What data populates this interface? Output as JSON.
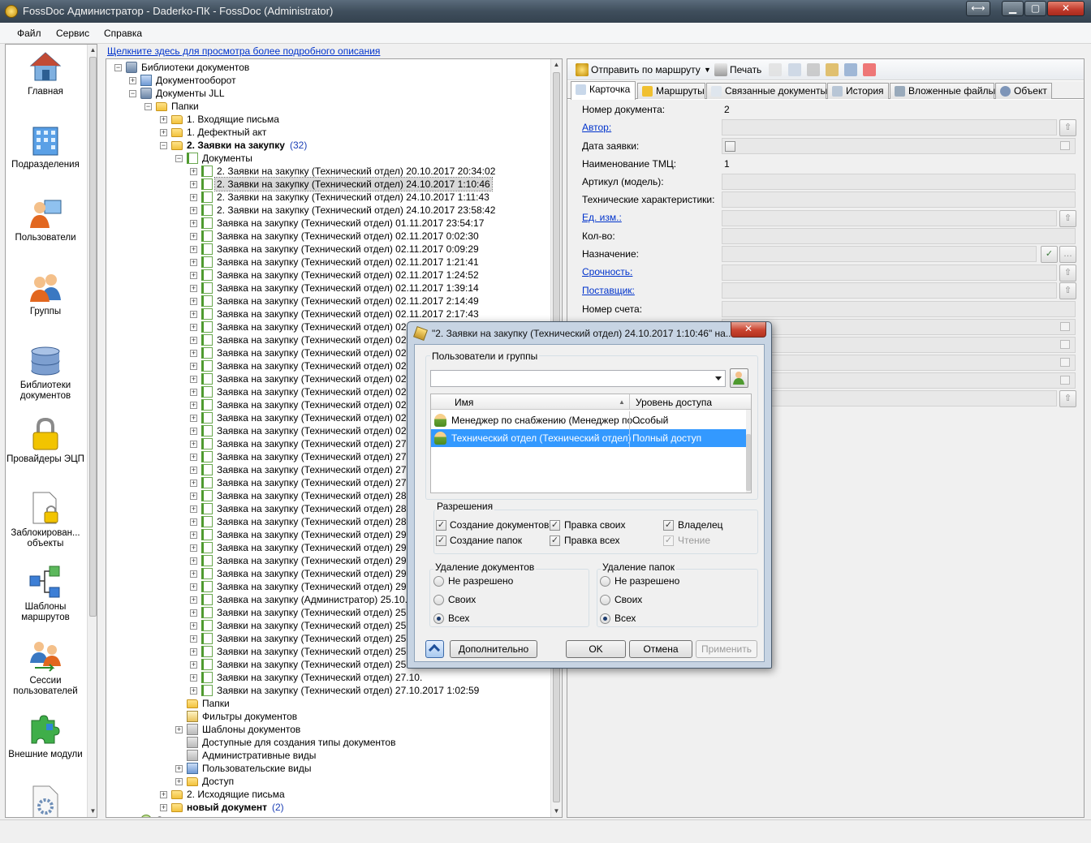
{
  "window": {
    "title": "FossDoc Администратор - Daderko-ПК - FossDoc (Administrator)"
  },
  "menu": [
    "Файл",
    "Сервис",
    "Справка"
  ],
  "nav": [
    {
      "label": "Главная",
      "icon": "house-icon"
    },
    {
      "label": "Подразделения",
      "icon": "building-icon"
    },
    {
      "label": "Пользователи",
      "icon": "user-computer-icon"
    },
    {
      "label": "Группы",
      "icon": "group-icon"
    },
    {
      "label": "Библиотеки документов",
      "icon": "database-icon"
    },
    {
      "label": "Провайдеры ЭЦП",
      "icon": "padlock-icon"
    },
    {
      "label": "Заблокирован... объекты",
      "icon": "locked-document-icon"
    },
    {
      "label": "Шаблоны маршрутов",
      "icon": "route-template-icon"
    },
    {
      "label": "Сессии пользователей",
      "icon": "sessions-icon"
    },
    {
      "label": "Внешние модули",
      "icon": "puzzle-icon"
    },
    {
      "label": "",
      "icon": "settings-document-icon"
    }
  ],
  "info_link": "Щелкните здесь для просмотра более подробного описания",
  "tree": [
    {
      "level": 0,
      "exp": "−",
      "icon": "lib",
      "text": "Библиотеки документов"
    },
    {
      "level": 1,
      "exp": "+",
      "icon": "blue",
      "text": "Документооборот"
    },
    {
      "level": 1,
      "exp": "−",
      "icon": "lib",
      "text": "Документы JLL"
    },
    {
      "level": 2,
      "exp": "−",
      "icon": "folder",
      "text": "Папки"
    },
    {
      "level": 3,
      "exp": "+",
      "icon": "folder",
      "text": "1. Входящие письма"
    },
    {
      "level": 3,
      "exp": "+",
      "icon": "folder",
      "text": "1. Дефектный акт"
    },
    {
      "level": 3,
      "exp": "−",
      "icon": "folder",
      "text": "2. Заявки на закупку",
      "bold": true,
      "count": "(32)"
    },
    {
      "level": 4,
      "exp": "−",
      "icon": "doc",
      "text": "Документы"
    },
    {
      "level": 5,
      "exp": "+",
      "icon": "doc",
      "text": "2. Заявки на закупку (Технический отдел) 20.10.2017 20:34:02"
    },
    {
      "level": 5,
      "exp": "+",
      "icon": "doc",
      "text": "2. Заявки на закупку (Технический отдел) 24.10.2017 1:10:46",
      "selected": true
    },
    {
      "level": 5,
      "exp": "+",
      "icon": "doc",
      "text": "2. Заявки на закупку (Технический отдел) 24.10.2017 1:11:43"
    },
    {
      "level": 5,
      "exp": "+",
      "icon": "doc",
      "text": "2. Заявки на закупку (Технический отдел) 24.10.2017 23:58:42"
    },
    {
      "level": 5,
      "exp": "+",
      "icon": "doc",
      "text": "Заявка на закупку (Технический отдел) 01.11.2017 23:54:17"
    },
    {
      "level": 5,
      "exp": "+",
      "icon": "doc",
      "text": "Заявка на закупку (Технический отдел) 02.11.2017 0:02:30"
    },
    {
      "level": 5,
      "exp": "+",
      "icon": "doc",
      "text": "Заявка на закупку (Технический отдел) 02.11.2017 0:09:29"
    },
    {
      "level": 5,
      "exp": "+",
      "icon": "doc",
      "text": "Заявка на закупку (Технический отдел) 02.11.2017 1:21:41"
    },
    {
      "level": 5,
      "exp": "+",
      "icon": "doc",
      "text": "Заявка на закупку (Технический отдел) 02.11.2017 1:24:52"
    },
    {
      "level": 5,
      "exp": "+",
      "icon": "doc",
      "text": "Заявка на закупку (Технический отдел) 02.11.2017 1:39:14"
    },
    {
      "level": 5,
      "exp": "+",
      "icon": "doc",
      "text": "Заявка на закупку (Технический отдел) 02.11.2017 2:14:49"
    },
    {
      "level": 5,
      "exp": "+",
      "icon": "doc",
      "text": "Заявка на закупку (Технический отдел) 02.11.2017 2:17:43"
    },
    {
      "level": 5,
      "exp": "+",
      "icon": "doc",
      "text": "Заявка на закупку (Технический отдел) 02.11."
    },
    {
      "level": 5,
      "exp": "+",
      "icon": "doc",
      "text": "Заявка на закупку (Технический отдел) 02.11."
    },
    {
      "level": 5,
      "exp": "+",
      "icon": "doc",
      "text": "Заявка на закупку (Технический отдел) 02.11."
    },
    {
      "level": 5,
      "exp": "+",
      "icon": "doc",
      "text": "Заявка на закупку (Технический отдел) 02.11."
    },
    {
      "level": 5,
      "exp": "+",
      "icon": "doc",
      "text": "Заявка на закупку (Технический отдел) 02.11."
    },
    {
      "level": 5,
      "exp": "+",
      "icon": "doc",
      "text": "Заявка на закупку (Технический отдел) 02.11."
    },
    {
      "level": 5,
      "exp": "+",
      "icon": "doc",
      "text": "Заявка на закупку (Технический отдел) 02.11."
    },
    {
      "level": 5,
      "exp": "+",
      "icon": "doc",
      "text": "Заявка на закупку (Технический отдел) 02.11."
    },
    {
      "level": 5,
      "exp": "+",
      "icon": "doc",
      "text": "Заявка на закупку (Технический отдел) 02.11."
    },
    {
      "level": 5,
      "exp": "+",
      "icon": "doc",
      "text": "Заявка на закупку (Технический отдел) 27.10."
    },
    {
      "level": 5,
      "exp": "+",
      "icon": "doc",
      "text": "Заявка на закупку (Технический отдел) 27.10."
    },
    {
      "level": 5,
      "exp": "+",
      "icon": "doc",
      "text": "Заявка на закупку (Технический отдел) 27.10."
    },
    {
      "level": 5,
      "exp": "+",
      "icon": "doc",
      "text": "Заявка на закупку (Технический отдел) 27.10."
    },
    {
      "level": 5,
      "exp": "+",
      "icon": "doc",
      "text": "Заявка на закупку (Технический отдел) 28.10."
    },
    {
      "level": 5,
      "exp": "+",
      "icon": "doc",
      "text": "Заявка на закупку (Технический отдел) 28.10."
    },
    {
      "level": 5,
      "exp": "+",
      "icon": "doc",
      "text": "Заявка на закупку (Технический отдел) 28.10."
    },
    {
      "level": 5,
      "exp": "+",
      "icon": "doc",
      "text": "Заявка на закупку (Технический отдел) 29.10."
    },
    {
      "level": 5,
      "exp": "+",
      "icon": "doc",
      "text": "Заявка на закупку (Технический отдел) 29.10."
    },
    {
      "level": 5,
      "exp": "+",
      "icon": "doc",
      "text": "Заявка на закупку (Технический отдел) 29.10."
    },
    {
      "level": 5,
      "exp": "+",
      "icon": "doc",
      "text": "Заявка на закупку (Технический отдел) 29.10."
    },
    {
      "level": 5,
      "exp": "+",
      "icon": "doc",
      "text": "Заявка на закупку (Технический отдел) 29.10."
    },
    {
      "level": 5,
      "exp": "+",
      "icon": "doc",
      "text": "Заявка на закупку (Администратор) 25.10.2017"
    },
    {
      "level": 5,
      "exp": "+",
      "icon": "doc",
      "text": "Заявки на закупку (Технический отдел) 25.10."
    },
    {
      "level": 5,
      "exp": "+",
      "icon": "doc",
      "text": "Заявки на закупку (Технический отдел) 25.10."
    },
    {
      "level": 5,
      "exp": "+",
      "icon": "doc",
      "text": "Заявки на закупку (Технический отдел) 25.10."
    },
    {
      "level": 5,
      "exp": "+",
      "icon": "doc",
      "text": "Заявки на закупку (Технический отдел) 25.10."
    },
    {
      "level": 5,
      "exp": "+",
      "icon": "doc",
      "text": "Заявки на закупку (Технический отдел) 25.10."
    },
    {
      "level": 5,
      "exp": "+",
      "icon": "doc",
      "text": "Заявки на закупку (Технический отдел) 27.10."
    },
    {
      "level": 5,
      "exp": "+",
      "icon": "doc",
      "text": "Заявки на закупку (Технический отдел) 27.10.2017 1:02:59"
    },
    {
      "level": 4,
      "exp": "",
      "icon": "folder",
      "text": "Папки"
    },
    {
      "level": 4,
      "exp": "",
      "icon": "filter",
      "text": "Фильтры документов"
    },
    {
      "level": 4,
      "exp": "+",
      "icon": "gray",
      "text": "Шаблоны документов"
    },
    {
      "level": 4,
      "exp": "",
      "icon": "gray",
      "text": "Доступные для создания типы документов"
    },
    {
      "level": 4,
      "exp": "",
      "icon": "gray",
      "text": "Административные виды"
    },
    {
      "level": 4,
      "exp": "+",
      "icon": "blue",
      "text": "Пользовательские виды"
    },
    {
      "level": 4,
      "exp": "+",
      "icon": "folder",
      "text": "Доступ"
    },
    {
      "level": 3,
      "exp": "+",
      "icon": "folder",
      "text": "2. Исходящие письма"
    },
    {
      "level": 3,
      "exp": "+",
      "icon": "folder",
      "text": "новый документ",
      "bold": true,
      "count": "(2)"
    },
    {
      "level": 1,
      "exp": "+",
      "icon": "green",
      "text": "Справочники"
    },
    {
      "level": 1,
      "exp": "+",
      "icon": "gray",
      "text": "Т..."
    }
  ],
  "toolbar": {
    "send_route": "Отправить по маршруту",
    "print": "Печать"
  },
  "tabs": [
    "Карточка",
    "Маршруты",
    "Связанные документы",
    "История",
    "Вложенные файлы",
    "Объект"
  ],
  "form": {
    "doc_number_label": "Номер документа:",
    "doc_number_value": "2",
    "author_label": "Автор:",
    "date_label": "Дата заявки:",
    "tmc_label": "Наименование ТМЦ:",
    "tmc_value": "1",
    "article_label": "Артикул (модель):",
    "tech_label": "Технические характеристики:",
    "unit_label": "Ед. изм.:",
    "qty_label": "Кол-во:",
    "purpose_label": "Назначение:",
    "urgency_label": "Срочность:",
    "supplier_label": "Поставщик:",
    "invoice_label": "Номер счета:"
  },
  "dialog": {
    "title": "\"2. Заявки на закупку (Технический отдел) 24.10.2017 1:10:46\" на...",
    "users_groups_title": "Пользователи и группы",
    "combo_value": "",
    "col_name": "Имя",
    "col_access": "Уровень доступа",
    "rows": [
      {
        "name": "Менеджер по снабжению (Менеджер по ...",
        "access": "Особый",
        "selected": false
      },
      {
        "name": "Технический отдел (Технический отдел)",
        "access": "Полный доступ",
        "selected": true
      }
    ],
    "permissions_title": "Разрешения",
    "permissions": [
      {
        "label": "Создание документов",
        "checked": true,
        "disabled": false
      },
      {
        "label": "Правка своих",
        "checked": true,
        "disabled": false
      },
      {
        "label": "Владелец",
        "checked": true,
        "disabled": false
      },
      {
        "label": "Создание папок",
        "checked": true,
        "disabled": false
      },
      {
        "label": "Правка всех",
        "checked": true,
        "disabled": false
      },
      {
        "label": "Чтение",
        "checked": true,
        "disabled": true
      }
    ],
    "delete_docs_title": "Удаление документов",
    "delete_folders_title": "Удаление папок",
    "radio_options": [
      "Не разрешено",
      "Своих",
      "Всех"
    ],
    "delete_docs_selected": 2,
    "delete_folders_selected": 2,
    "btn_more": "Дополнительно",
    "btn_ok": "OK",
    "btn_cancel": "Отмена",
    "btn_apply": "Применить"
  }
}
